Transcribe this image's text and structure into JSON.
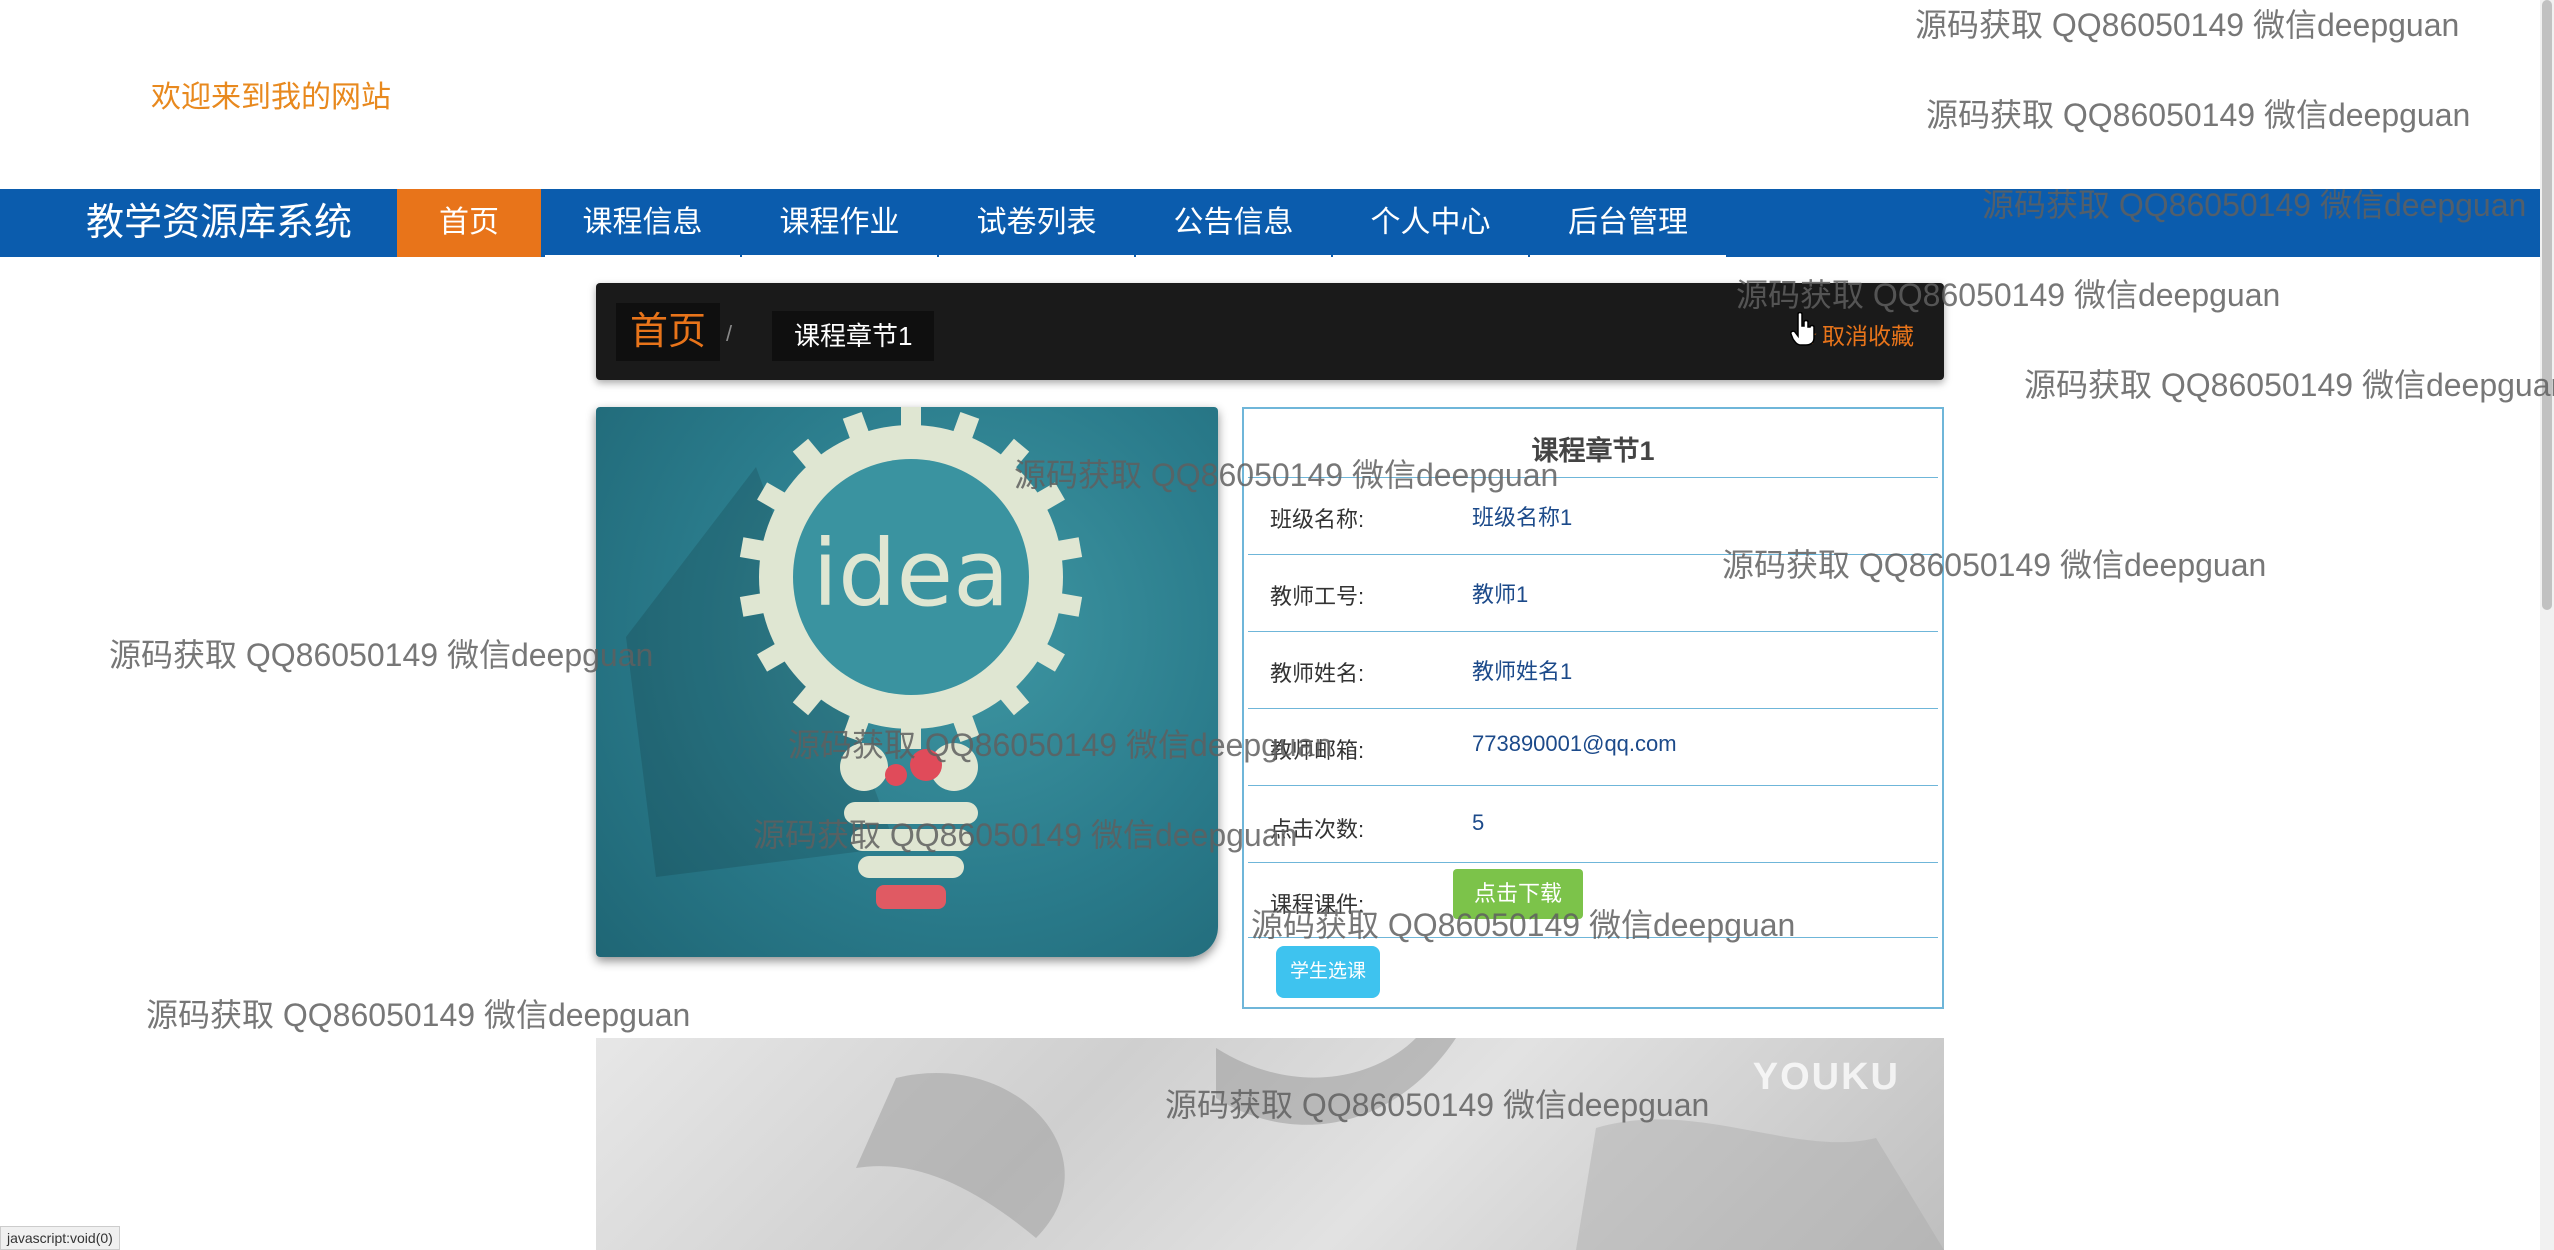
{
  "header": {
    "welcome": "欢迎来到我的网站"
  },
  "navbar": {
    "brand": "教学资源库系统",
    "items": [
      {
        "label": "首页",
        "active": true
      },
      {
        "label": "课程信息"
      },
      {
        "label": "课程作业"
      },
      {
        "label": "试卷列表"
      },
      {
        "label": "公告信息"
      },
      {
        "label": "个人中心"
      },
      {
        "label": "后台管理"
      }
    ]
  },
  "breadcrumb": {
    "home": "首页",
    "separator": "/",
    "current": "课程章节1",
    "favorite": "取消收藏",
    "favorite_icon": "star-icon"
  },
  "detail": {
    "title": "课程章节1",
    "rows": [
      {
        "label": "班级名称:",
        "value": "班级名称1"
      },
      {
        "label": "教师工号:",
        "value": "教师1"
      },
      {
        "label": "教师姓名:",
        "value": "教师姓名1"
      },
      {
        "label": "教师邮箱:",
        "value": "773890001@qq.com"
      },
      {
        "label": "点击次数:",
        "value": "5"
      },
      {
        "label": "课程课件:",
        "button": "点击下载"
      }
    ],
    "select_button": "学生选课"
  },
  "image": {
    "text": "idea"
  },
  "video": {
    "logo": "YOUKU"
  },
  "statusbar": {
    "text": "javascript:void(0)"
  },
  "watermark": "源码获取 QQ86050149 微信deepguan",
  "colors": {
    "nav": "#0b5cad",
    "accent": "#e8741a",
    "welcome": "#e8891e",
    "download": "#7cc34a",
    "select": "#3ec3ef",
    "border": "#6fb6d9"
  }
}
